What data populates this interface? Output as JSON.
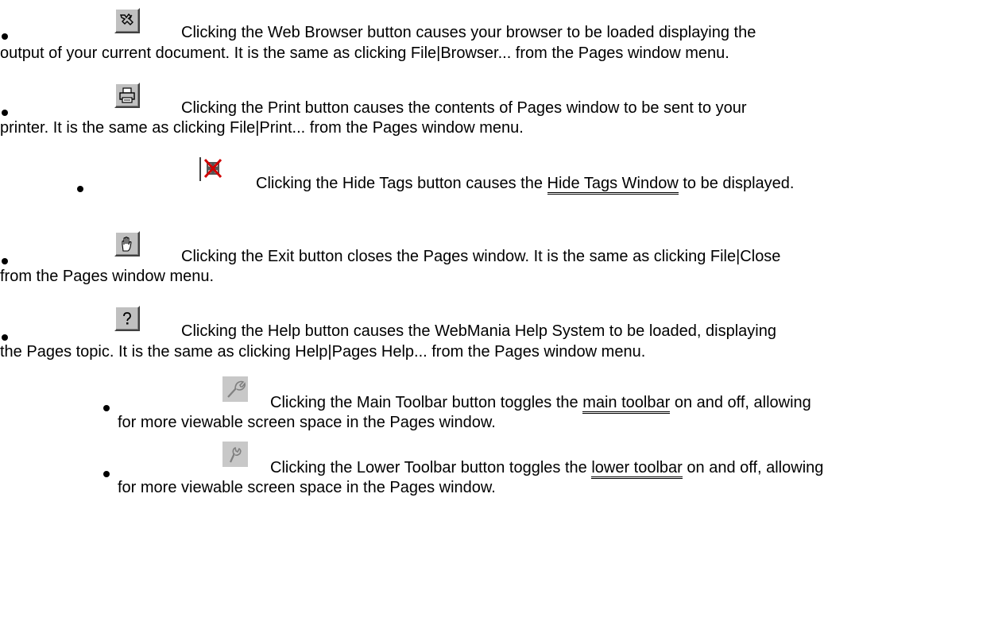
{
  "items": [
    {
      "icon": "web-browser-icon",
      "line1": "Clicking the Web Browser button causes your browser to be loaded displaying the",
      "line2": "output of your current document.   It is the same as clicking File|Browser... from the Pages window menu."
    },
    {
      "icon": "printer-icon",
      "line1": "Clicking the Print button causes the contents of Pages window to be sent to your",
      "line2": "printer.   It is the same as clicking File|Print... from the Pages window menu."
    },
    {
      "icon": "hide-tags-icon",
      "pre": "Clicking the Hide Tags button causes the ",
      "link": "Hide Tags Window",
      "post": " to be displayed."
    },
    {
      "icon": "hand-stop-icon",
      "line1": "Clicking the Exit button closes the Pages window.   It is the same as clicking File|Close",
      "line2": "from the Pages window menu."
    },
    {
      "icon": "help-question-icon",
      "line1": "Clicking the Help button causes the WebMania Help System to be loaded, displaying",
      "line2": "the Pages topic.   It is the same as clicking Help|Pages Help... from the Pages window menu."
    },
    {
      "icon": "wrench-icon",
      "pre": "Clicking the Main Toolbar button toggles the ",
      "link": "main toolbar",
      "post": " on and off, allowing",
      "line2": "for more viewable screen space in the Pages window."
    },
    {
      "icon": "wrench-lower-icon",
      "pre": "Clicking the Lower Toolbar button toggles the ",
      "link": "lower toolbar",
      "post": " on and off, allowing",
      "line2": "for more viewable screen space in the Pages window."
    }
  ]
}
